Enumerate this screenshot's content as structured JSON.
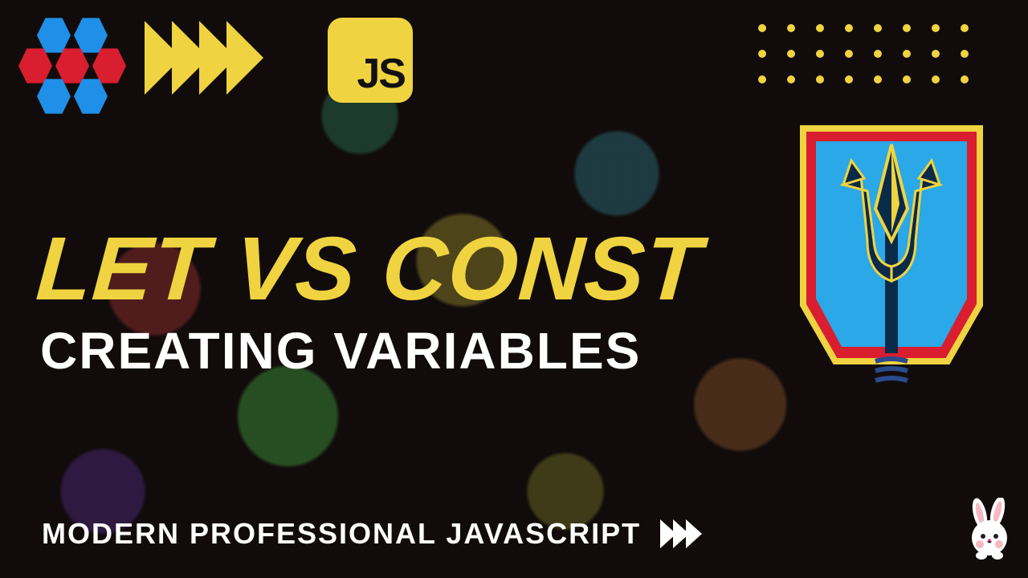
{
  "header": {
    "js_badge_text": "JS"
  },
  "headline": {
    "title": "LET VS CONST",
    "subtitle": "CREATING VARIABLES"
  },
  "footer": {
    "text": "MODERN PROFESSIONAL JAVASCRIPT"
  },
  "decor": {
    "dot_rows": 3,
    "dot_cols": 8,
    "big_chevron_count": 4,
    "small_chevron_count": 3
  },
  "colors": {
    "accent_yellow": "#f0d340",
    "hex_blue": "#1f8fe8",
    "hex_red": "#d91e2f"
  }
}
